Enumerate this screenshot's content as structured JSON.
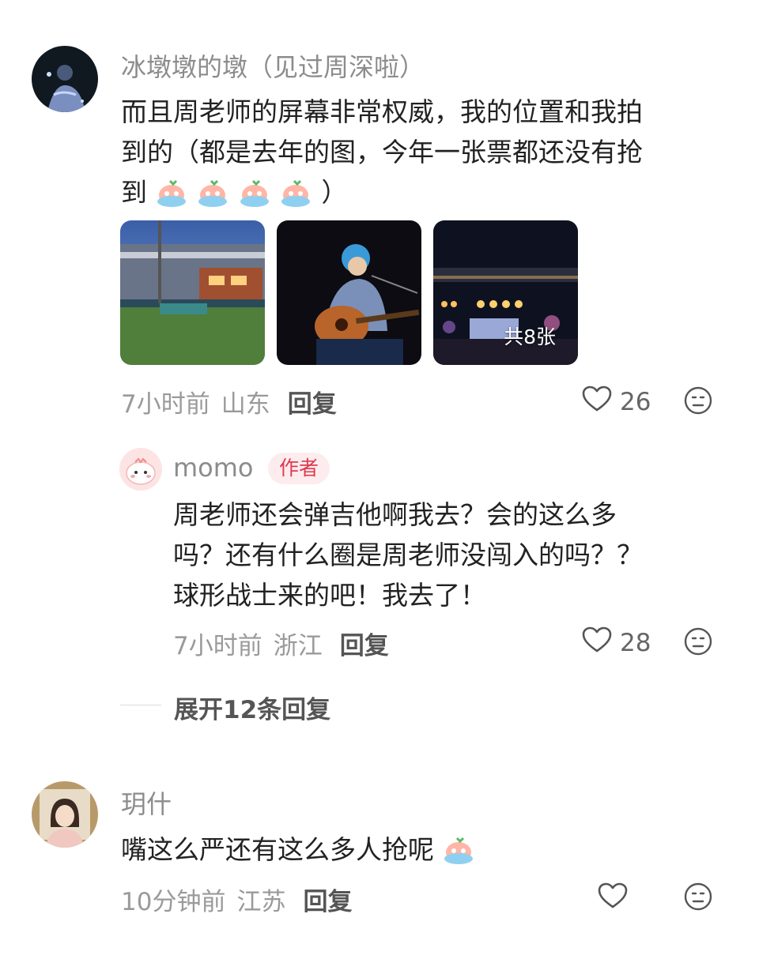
{
  "comments": [
    {
      "username": "冰墩墩的墩（见过周深啦）",
      "text_lines": [
        "而且周老师的屏幕非常权威，我的位置和我拍",
        "到的（都是去年的图，今年一张票都还没有抢"
      ],
      "text_last_prefix": "到",
      "text_last_suffix": "）",
      "emoji_icon": "crying-peach-emoji",
      "emoji_count": 4,
      "images_count_label": "共8张",
      "time": "7小时前",
      "location": "山东",
      "reply_label": "回复",
      "likes": "26"
    },
    {
      "username": "momo",
      "badge": "作者",
      "text_lines": [
        "周老师还会弹吉他啊我去？会的这么多",
        "吗？还有什么圈是周老师没闯入的吗？？",
        "球形战士来的吧！我去了！"
      ],
      "time": "7小时前",
      "location": "浙江",
      "reply_label": "回复",
      "likes": "28"
    },
    {
      "username": "玥什",
      "text": "嘴这么严还有这么多人抢呢",
      "emoji_icon": "crying-peach-emoji",
      "time": "10分钟前",
      "location": "江苏",
      "reply_label": "回复",
      "likes": ""
    }
  ],
  "expand_replies": "展开12条回复",
  "colors": {
    "username": "#8c8c8c",
    "text": "#222222",
    "meta": "#9a9a9a",
    "author_badge_text": "#e0384f",
    "author_badge_bg": "#fdecee"
  },
  "icons": {
    "like": "heart-outline-icon",
    "emoji": "smiley-face-icon"
  }
}
